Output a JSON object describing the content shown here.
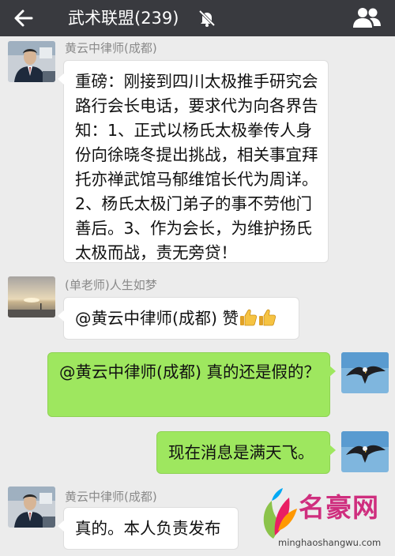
{
  "header": {
    "title": "武术联盟(239)",
    "back_icon": "back-arrow-icon",
    "mute_icon": "bell-off-icon",
    "group_icon": "group-members-icon",
    "background": "#393a3f"
  },
  "messages": [
    {
      "side": "left",
      "sender": "黄云中律师(成都)",
      "text": "重磅：刚接到四川太极推手研究会路行会长电话，要求代为向各界告知：1、正式以杨氏太极拳传人身份向徐晓冬提出挑战，相关事宜拜托亦禅武馆马郁维馆长代为周详。2、杨氏太极门弟子的事不劳他门善后。3、作为会长，为维护扬氏太极而战，责无旁贷！"
    },
    {
      "side": "left",
      "sender": "(单老师)人生如梦",
      "text": "@黄云中律师(成都) 赞",
      "emoji": [
        "thumbs-up-emoji",
        "thumbs-up-emoji"
      ]
    },
    {
      "side": "right",
      "sender": "",
      "text": "@黄云中律师(成都) 真的还是假的？"
    },
    {
      "side": "right",
      "sender": "",
      "text": "现在消息是满天飞。"
    },
    {
      "side": "left",
      "sender": "黄云中律师(成都)",
      "text": "真的。本人负责发布"
    }
  ],
  "watermark": {
    "name": "名豪网",
    "url": "minghaoshangwu.com"
  },
  "colors": {
    "chat_background": "#ececec",
    "bubble_left": "#ffffff",
    "bubble_right": "#9ee75f",
    "sender_name": "#8a8a8a",
    "watermark_text": "#cf2e7e"
  }
}
